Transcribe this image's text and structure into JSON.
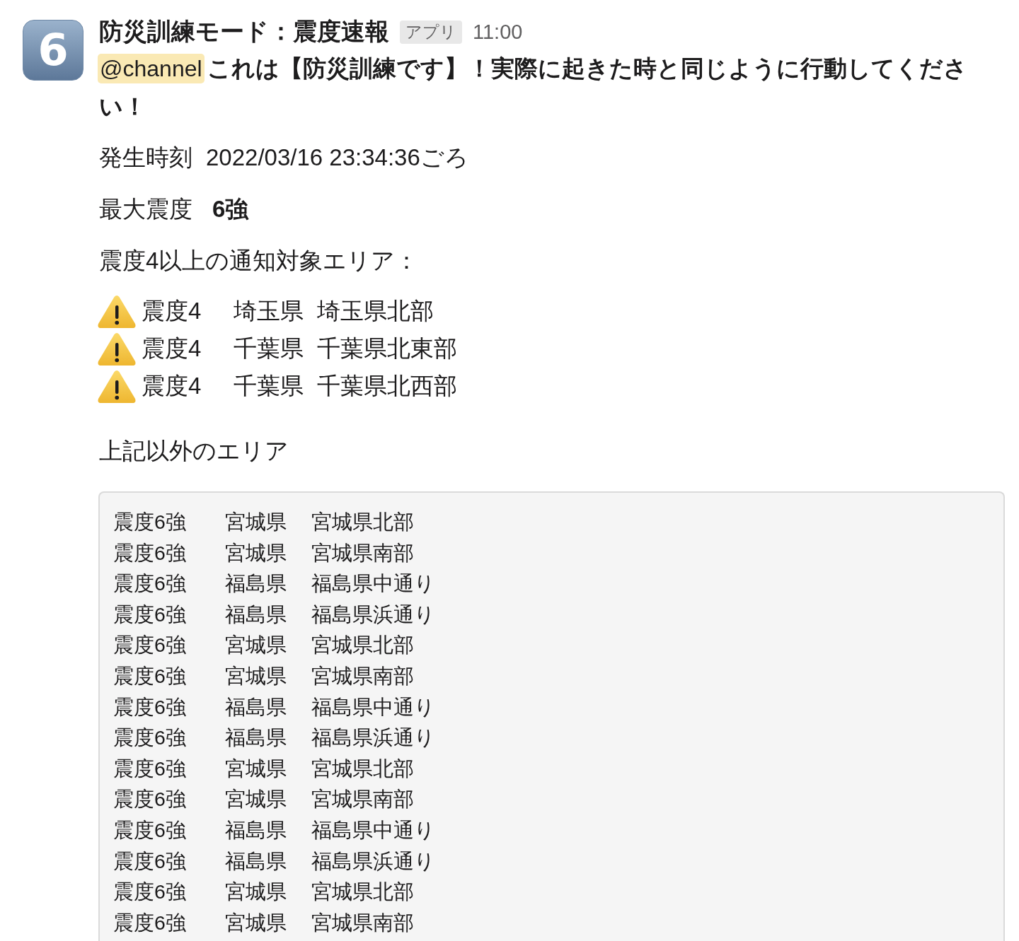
{
  "message": {
    "avatar": {
      "label": "6"
    },
    "sender": "防災訓練モード：震度速報",
    "badge": "アプリ",
    "time": "11:00",
    "mention": "@channel",
    "text": "これは【防災訓練です】！実際に起きた時と同じように行動してください！",
    "details": [
      {
        "label": "発生時刻",
        "value": "2022/03/16 23:34:36ごろ",
        "bold": false
      },
      {
        "label": "最大震度",
        "value": "6強",
        "bold": true
      }
    ],
    "notify_heading": "震度4以上の通知対象エリア：",
    "notify_areas": [
      {
        "intensity": "震度4",
        "prefecture": "埼玉県",
        "area": "埼玉県北部"
      },
      {
        "intensity": "震度4",
        "prefecture": "千葉県",
        "area": "千葉県北東部"
      },
      {
        "intensity": "震度4",
        "prefecture": "千葉県",
        "area": "千葉県北西部"
      }
    ],
    "other_heading": "上記以外のエリア",
    "other_areas": [
      {
        "intensity": "震度6強",
        "prefecture": "宮城県",
        "area": "宮城県北部"
      },
      {
        "intensity": "震度6強",
        "prefecture": "宮城県",
        "area": "宮城県南部"
      },
      {
        "intensity": "震度6強",
        "prefecture": "福島県",
        "area": "福島県中通り"
      },
      {
        "intensity": "震度6強",
        "prefecture": "福島県",
        "area": "福島県浜通り"
      },
      {
        "intensity": "震度6強",
        "prefecture": "宮城県",
        "area": "宮城県北部"
      },
      {
        "intensity": "震度6強",
        "prefecture": "宮城県",
        "area": "宮城県南部"
      },
      {
        "intensity": "震度6強",
        "prefecture": "福島県",
        "area": "福島県中通り"
      },
      {
        "intensity": "震度6強",
        "prefecture": "福島県",
        "area": "福島県浜通り"
      },
      {
        "intensity": "震度6強",
        "prefecture": "宮城県",
        "area": "宮城県北部"
      },
      {
        "intensity": "震度6強",
        "prefecture": "宮城県",
        "area": "宮城県南部"
      },
      {
        "intensity": "震度6強",
        "prefecture": "福島県",
        "area": "福島県中通り"
      },
      {
        "intensity": "震度6強",
        "prefecture": "福島県",
        "area": "福島県浜通り"
      },
      {
        "intensity": "震度6強",
        "prefecture": "宮城県",
        "area": "宮城県北部"
      },
      {
        "intensity": "震度6強",
        "prefecture": "宮城県",
        "area": "宮城県南部"
      }
    ]
  }
}
